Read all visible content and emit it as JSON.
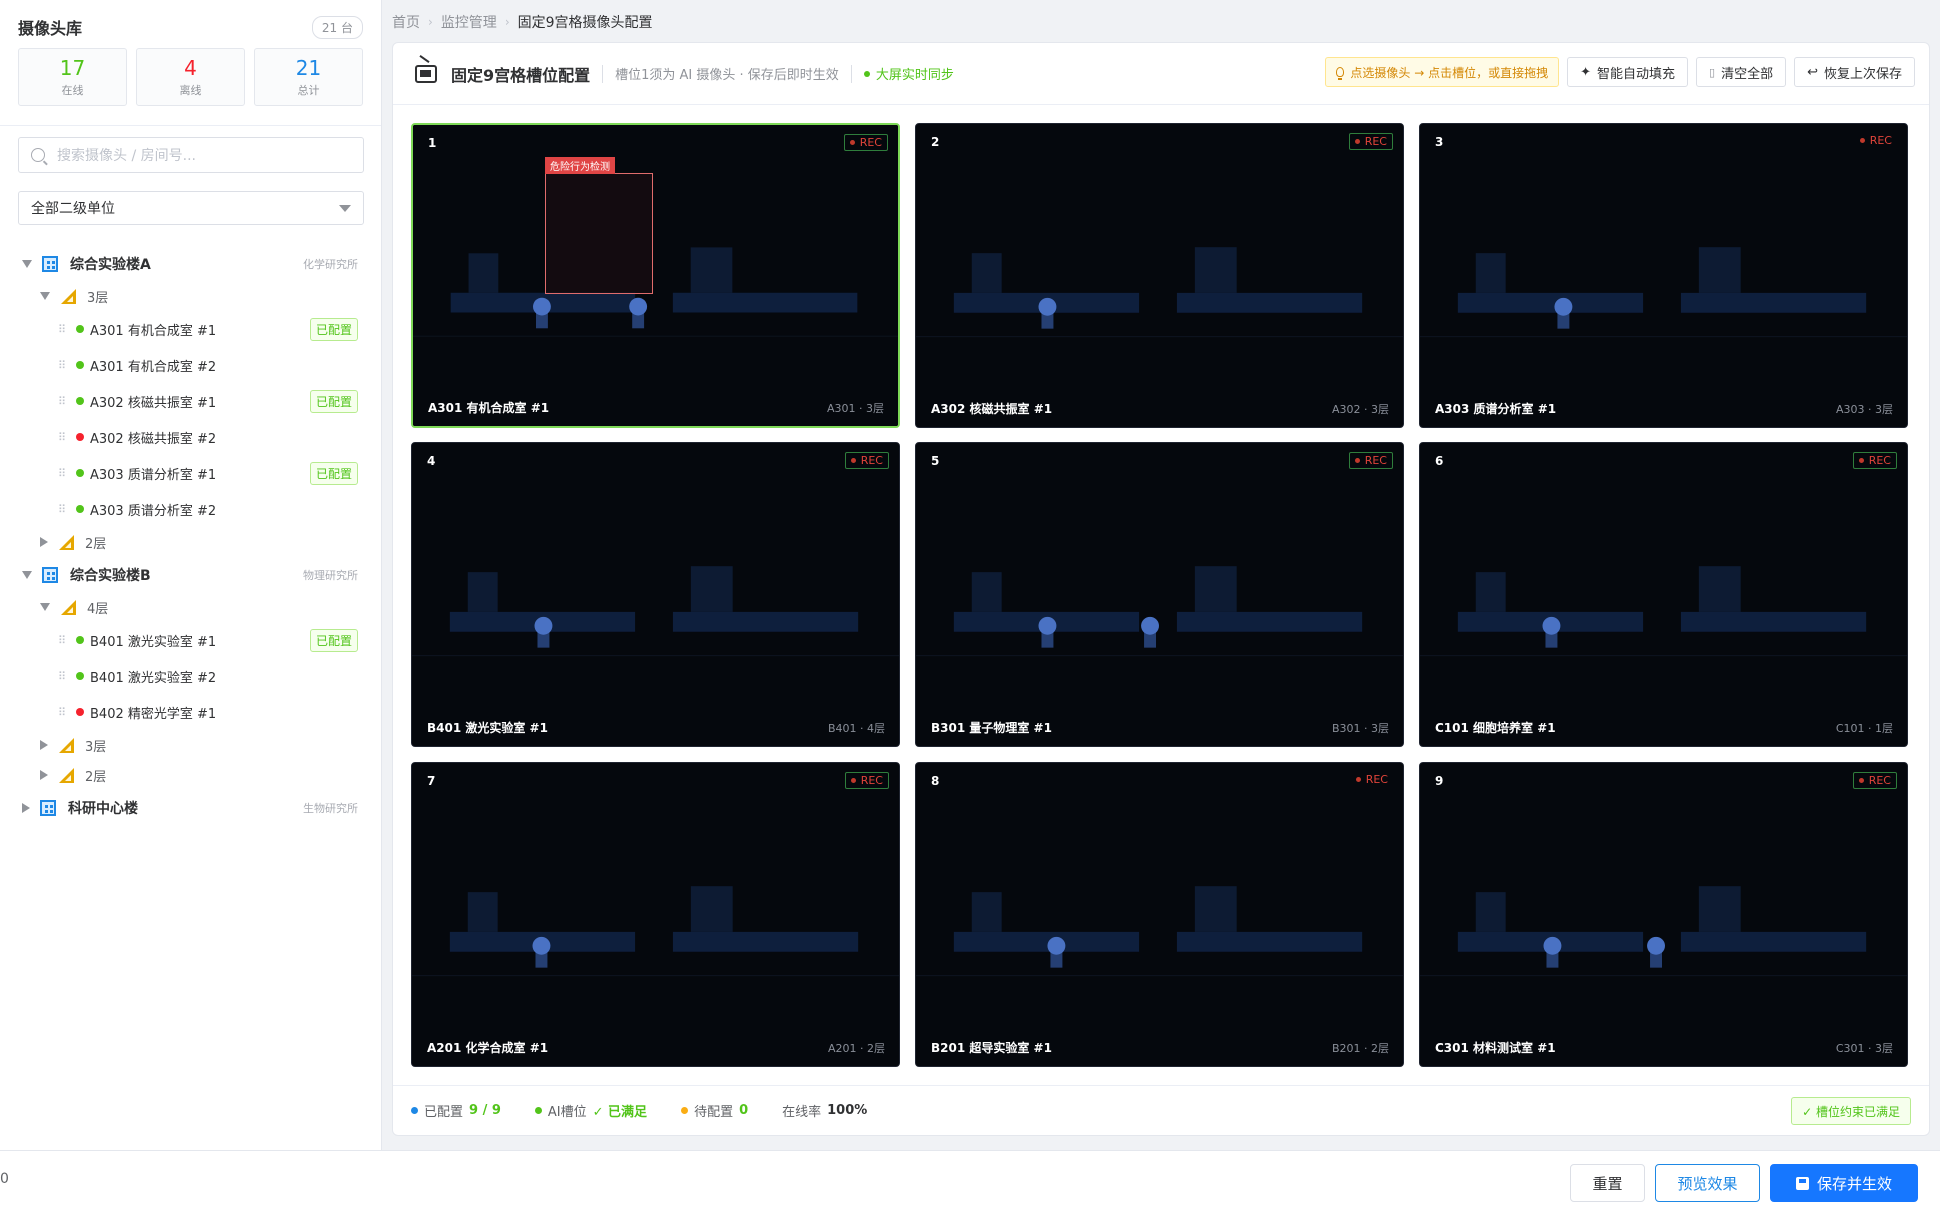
{
  "library": {
    "title": "摄像头库",
    "count_badge": "21 台",
    "stats": [
      {
        "value": "17",
        "label": "在线",
        "color": "#52c41a"
      },
      {
        "value": "4",
        "label": "离线",
        "color": "#f5222d"
      },
      {
        "value": "21",
        "label": "总计",
        "color": "#1e88e5"
      }
    ],
    "search_placeholder": "搜索摄像头 / 房间号...",
    "unit_select": "全部二级单位"
  },
  "tree": {
    "buildings": [
      {
        "name": "综合实验楼A",
        "org": "化学研究所",
        "expanded": true,
        "floors": [
          {
            "name": "3层",
            "expanded": true,
            "cameras": [
              {
                "name": "A301 有机合成室 #1",
                "status": "online",
                "tag": "已配置"
              },
              {
                "name": "A301 有机合成室 #2",
                "status": "online",
                "tag": ""
              },
              {
                "name": "A302 核磁共振室 #1",
                "status": "online",
                "tag": "已配置"
              },
              {
                "name": "A302 核磁共振室 #2",
                "status": "offline",
                "tag": ""
              },
              {
                "name": "A303 质谱分析室 #1",
                "status": "online",
                "tag": "已配置"
              },
              {
                "name": "A303 质谱分析室 #2",
                "status": "online",
                "tag": ""
              }
            ]
          },
          {
            "name": "2层",
            "expanded": false,
            "cameras": []
          }
        ]
      },
      {
        "name": "综合实验楼B",
        "org": "物理研究所",
        "expanded": true,
        "floors": [
          {
            "name": "4层",
            "expanded": true,
            "cameras": [
              {
                "name": "B401 激光实验室 #1",
                "status": "online",
                "tag": "已配置"
              },
              {
                "name": "B401 激光实验室 #2",
                "status": "online",
                "tag": ""
              },
              {
                "name": "B402 精密光学室 #1",
                "status": "offline",
                "tag": ""
              }
            ]
          },
          {
            "name": "3层",
            "expanded": false,
            "cameras": []
          },
          {
            "name": "2层",
            "expanded": false,
            "cameras": []
          }
        ]
      },
      {
        "name": "科研中心楼",
        "org": "生物研究所",
        "expanded": false,
        "floors": []
      }
    ]
  },
  "breadcrumb": [
    "首页",
    "监控管理",
    "固定9宫格摄像头配置"
  ],
  "panel": {
    "title": "固定9宫格槽位配置",
    "subtitle": "槽位1须为 AI 摄像头 · 保存后即时生效",
    "sync": "大屏实时同步",
    "hint": "点选摄像头 → 点击槽位，或直接拖拽",
    "auto_fill": "智能自动填充",
    "clear_all": "清空全部",
    "restore": "恢复上次保存"
  },
  "slots": [
    {
      "no": "1",
      "camera": "A301 有机合成室 #1",
      "loc": "A301 · 3层",
      "rec": "REC",
      "ai": true,
      "alert": "危险行为检测"
    },
    {
      "no": "2",
      "camera": "A302 核磁共振室 #1",
      "loc": "A302 · 3层",
      "rec": "REC",
      "ai": true,
      "alert": ""
    },
    {
      "no": "3",
      "camera": "A303 质谱分析室 #1",
      "loc": "A303 · 3层",
      "rec": "REC",
      "ai": false,
      "alert": ""
    },
    {
      "no": "4",
      "camera": "B401 激光实验室 #1",
      "loc": "B401 · 4层",
      "rec": "REC",
      "ai": true,
      "alert": ""
    },
    {
      "no": "5",
      "camera": "B301 量子物理室 #1",
      "loc": "B301 · 3层",
      "rec": "REC",
      "ai": true,
      "alert": ""
    },
    {
      "no": "6",
      "camera": "C101 细胞培养室 #1",
      "loc": "C101 · 1层",
      "rec": "REC",
      "ai": true,
      "alert": ""
    },
    {
      "no": "7",
      "camera": "A201 化学合成室 #1",
      "loc": "A201 · 2层",
      "rec": "REC",
      "ai": true,
      "alert": ""
    },
    {
      "no": "8",
      "camera": "B201 超导实验室 #1",
      "loc": "B201 · 2层",
      "rec": "REC",
      "ai": false,
      "alert": ""
    },
    {
      "no": "9",
      "camera": "C301 材料测试室 #1",
      "loc": "C301 · 3层",
      "rec": "REC",
      "ai": true,
      "alert": ""
    }
  ],
  "footer": {
    "configured_label": "已配置",
    "configured_value": "9 / 9",
    "ai_label": "AI槽位",
    "ai_value": "✓ 已满足",
    "pending_label": "待配置",
    "pending_value": "0",
    "online_label": "在线率",
    "online_value": "100%",
    "constraint": "✓ 槽位约束已满足"
  },
  "bottom": {
    "left_text": "0",
    "reset": "重置",
    "preview": "预览效果",
    "save": "保存并生效"
  },
  "colors": {
    "online": "#52c41a",
    "offline": "#f5222d",
    "primary": "#1677ff",
    "pending": "#faad14",
    "configured": "#1e88e5"
  }
}
